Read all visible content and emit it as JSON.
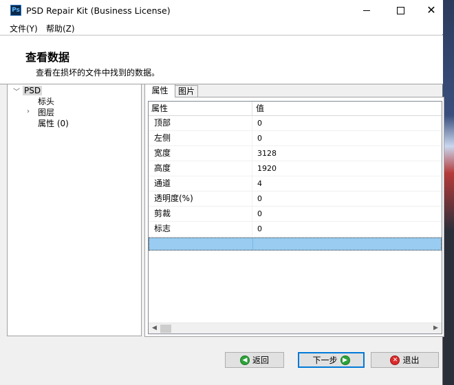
{
  "window": {
    "title": "PSD Repair Kit (Business License)",
    "app_icon_text": "Ps",
    "controls": {
      "minimize": "",
      "maximize": "",
      "close": "✕"
    }
  },
  "menu": {
    "file": "文件(Y)",
    "help": "帮助(Z)"
  },
  "header": {
    "title": "查看数据",
    "subtitle": "查看在损坏的文件中找到的数据。"
  },
  "tree": {
    "root": "PSD",
    "children": [
      "标头",
      "图层",
      "属性 (0)"
    ]
  },
  "tabs": [
    "属性",
    "图片"
  ],
  "grid": {
    "columns": [
      "属性",
      "值"
    ],
    "rows": [
      {
        "name": "顶部",
        "value": "0"
      },
      {
        "name": "左侧",
        "value": "0"
      },
      {
        "name": "宽度",
        "value": "3128"
      },
      {
        "name": "高度",
        "value": "1920"
      },
      {
        "name": "通道",
        "value": "4"
      },
      {
        "name": "透明度(%)",
        "value": "0"
      },
      {
        "name": "剪裁",
        "value": "0"
      },
      {
        "name": "标志",
        "value": "0"
      }
    ]
  },
  "buttons": {
    "back": "返回",
    "next": "下一步",
    "quit": "退出"
  },
  "icons": {
    "back": "arrow-left-circle-icon",
    "next": "arrow-right-circle-icon",
    "quit": "x-circle-icon"
  },
  "colors": {
    "selection": "#99ccf0",
    "accent": "#0078d7"
  }
}
